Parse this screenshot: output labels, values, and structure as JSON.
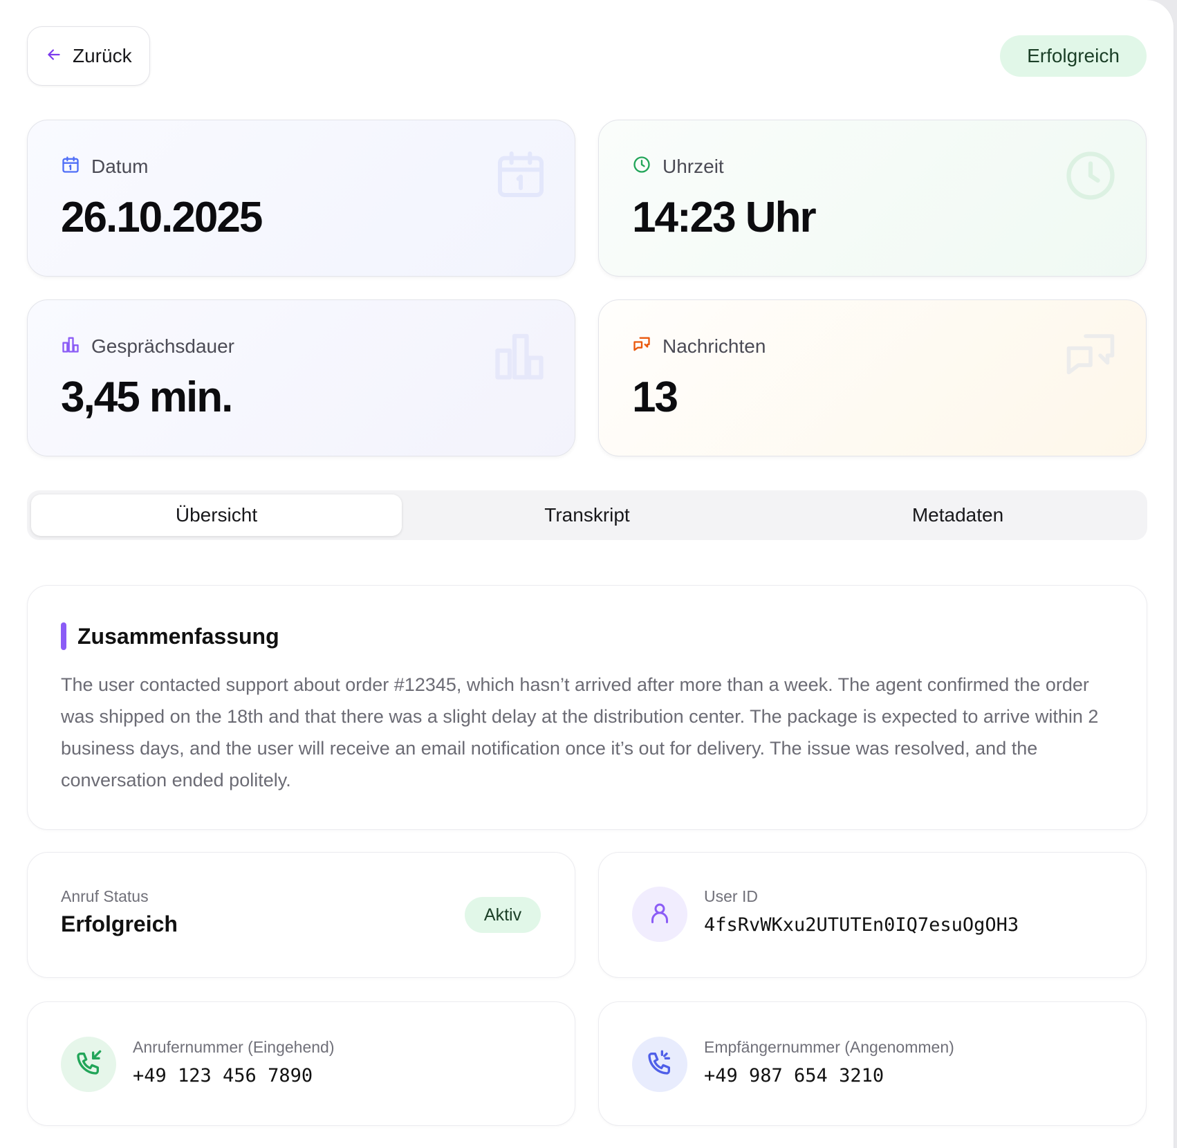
{
  "header": {
    "back_label": "Zurück",
    "status": "Erfolgreich"
  },
  "stats": [
    {
      "label": "Datum",
      "value": "26.10.2025",
      "icon": "calendar-icon",
      "color": "#4f6ef7"
    },
    {
      "label": "Uhrzeit",
      "value": "14:23 Uhr",
      "icon": "clock-icon",
      "color": "#22a559"
    },
    {
      "label": "Gesprächsdauer",
      "value": "3,45 min.",
      "icon": "bar-chart-icon",
      "color": "#8b5cf6"
    },
    {
      "label": "Nachrichten",
      "value": "13",
      "icon": "messages-icon",
      "color": "#ea580c"
    }
  ],
  "tabs": [
    {
      "label": "Übersicht",
      "active": true
    },
    {
      "label": "Transkript",
      "active": false
    },
    {
      "label": "Metadaten",
      "active": false
    }
  ],
  "summary": {
    "title": "Zusammenfassung",
    "text": "The user contacted support about order #12345, which hasn’t arrived after more than a week. The agent confirmed the order was shipped on the 18th and that there was a slight delay at the distribution center. The package is expected to arrive within 2 business days, and the user will receive an email notification once it’s out for delivery. The issue was resolved, and the conversation ended politely.",
    "accent": "#8b5cf6"
  },
  "call_status": {
    "label": "Anruf Status",
    "value": "Erfolgreich",
    "badge": "Aktiv"
  },
  "user": {
    "label": "User ID",
    "value": "4fsRvWKxu2UTUTEn0IQ7esuOgOH3",
    "icon": "user-icon"
  },
  "caller": {
    "label": "Anrufernummer (Eingehend)",
    "value": "+49 123 456 7890",
    "icon": "phone-incoming-icon"
  },
  "recipient": {
    "label": "Empfängernummer (Angenommen)",
    "value": "+49 987 654 3210",
    "icon": "phone-ringing-icon"
  }
}
